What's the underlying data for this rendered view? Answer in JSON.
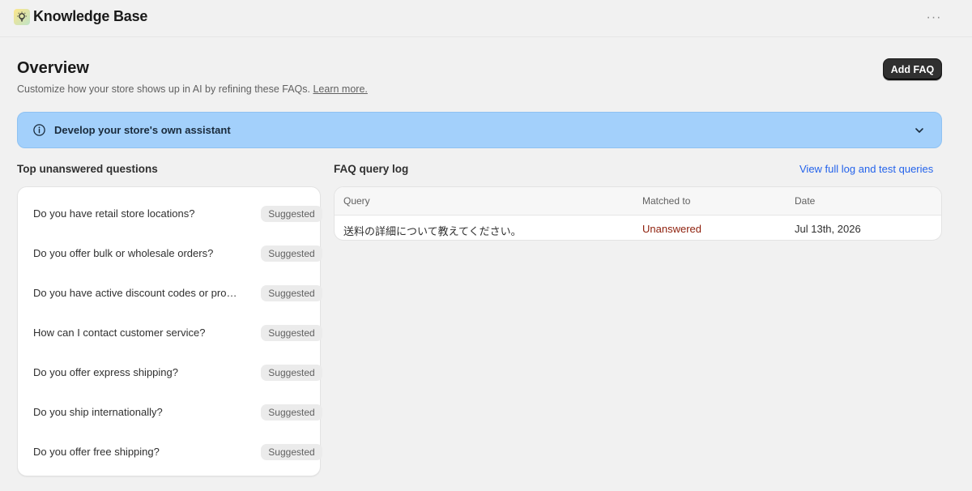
{
  "app": {
    "title": "Knowledge Base",
    "logo_icon": "lightbulb-icon",
    "menu_icon": "ellipsis-icon",
    "menu_label": "···"
  },
  "header": {
    "title": "Overview",
    "subtitle": "Customize how your store shows up in AI by refining these FAQs.",
    "learn_more": "Learn more.",
    "add_button": "Add FAQ"
  },
  "banner": {
    "text": "Develop your store's own assistant",
    "color": "#a3d0fb"
  },
  "unanswered": {
    "title": "Top unanswered questions",
    "items": [
      {
        "question": "Do you have retail store locations?",
        "badge": "Suggested"
      },
      {
        "question": "Do you offer bulk or wholesale orders?",
        "badge": "Suggested"
      },
      {
        "question": "Do you have active discount codes or promotions?",
        "badge": "Suggested"
      },
      {
        "question": "How can I contact customer service?",
        "badge": "Suggested"
      },
      {
        "question": "Do you offer express shipping?",
        "badge": "Suggested"
      },
      {
        "question": "Do you ship internationally?",
        "badge": "Suggested"
      },
      {
        "question": "Do you offer free shipping?",
        "badge": "Suggested"
      }
    ]
  },
  "query_log": {
    "title": "FAQ query log",
    "view_link": "View full log and test queries",
    "columns": [
      "Query",
      "Matched to",
      "Date"
    ],
    "rows": [
      {
        "query": "送料の詳細について教えてください。",
        "matched": "Unanswered",
        "date": "Jul 13th, 2026"
      }
    ]
  }
}
